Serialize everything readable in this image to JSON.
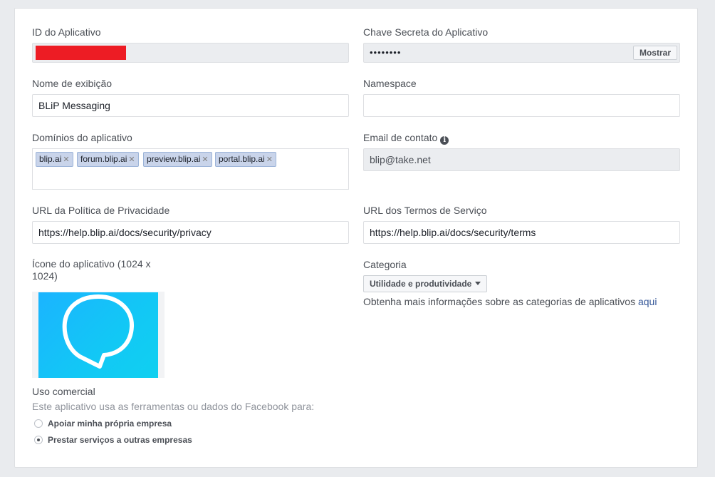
{
  "app_id": {
    "label": "ID do Aplicativo"
  },
  "app_secret": {
    "label": "Chave Secreta do Aplicativo",
    "masked_value": "••••••••",
    "show_button": "Mostrar"
  },
  "display_name": {
    "label": "Nome de exibição",
    "value": "BLiP Messaging"
  },
  "namespace": {
    "label": "Namespace",
    "value": ""
  },
  "app_domains": {
    "label": "Domínios do aplicativo",
    "tags": [
      "blip.ai",
      "forum.blip.ai",
      "preview.blip.ai",
      "portal.blip.ai"
    ],
    "remove_glyph": "✕"
  },
  "contact_email": {
    "label": "Email de contato",
    "info_glyph": "i",
    "value": "blip@take.net"
  },
  "privacy_url": {
    "label": "URL da Política de Privacidade",
    "value": "https://help.blip.ai/docs/security/privacy"
  },
  "terms_url": {
    "label": "URL dos Termos de Serviço",
    "value": "https://help.blip.ai/docs/security/terms"
  },
  "app_icon": {
    "label_line1": "Ícone do aplicativo (1024 x",
    "label_line2": "1024)",
    "icon": "speech-bubble-icon"
  },
  "category": {
    "label": "Categoria",
    "selected": "Utilidade e produtividade",
    "help_text": "Obtenha mais informações sobre as categorias de aplicativos",
    "help_link": "aqui"
  },
  "business_use": {
    "label": "Uso comercial",
    "description": "Este aplicativo usa as ferramentas ou dados do Facebook para:",
    "options": [
      {
        "label": "Apoiar minha própria empresa",
        "selected": false
      },
      {
        "label": "Prestar serviços a outras empresas",
        "selected": true
      }
    ]
  },
  "colors": {
    "link": "#365899",
    "tag_bg": "#c9d4ea",
    "redaction": "#ed1c24",
    "icon_bg": "#16bcf8"
  }
}
